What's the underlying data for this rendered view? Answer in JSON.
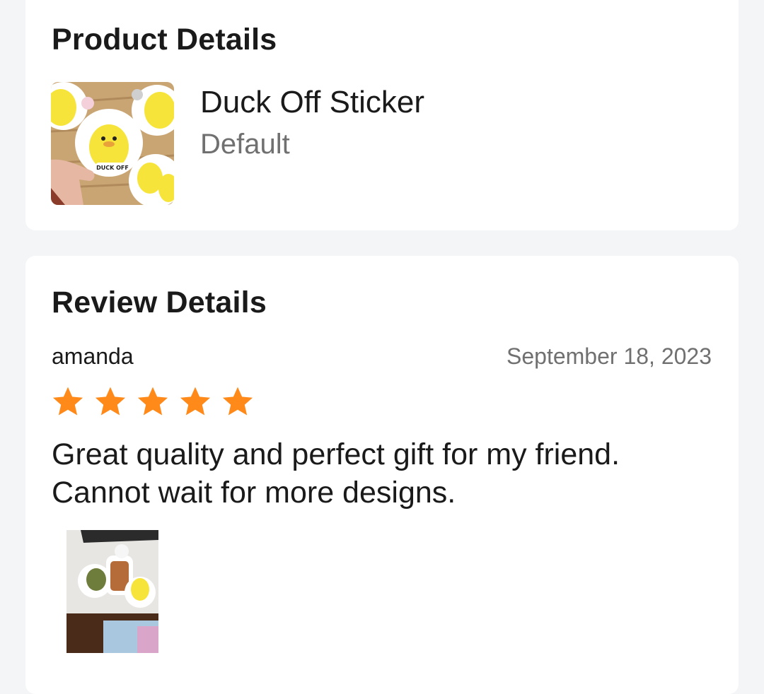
{
  "product_section": {
    "title": "Product Details",
    "product": {
      "name": "Duck Off Sticker",
      "variant": "Default",
      "thumbnail_sticker_text": "DUCK OFF"
    }
  },
  "review_section": {
    "title": "Review Details",
    "review": {
      "reviewer": "amanda",
      "date": "September 18, 2023",
      "rating": 5,
      "rating_max": 5,
      "text": "Great quality and perfect gift for my friend. Cannot wait for more designs."
    }
  },
  "colors": {
    "page_background": "#f4f5f7",
    "card_background": "#ffffff",
    "star": "#ff8a1a",
    "muted_text": "#707070"
  }
}
